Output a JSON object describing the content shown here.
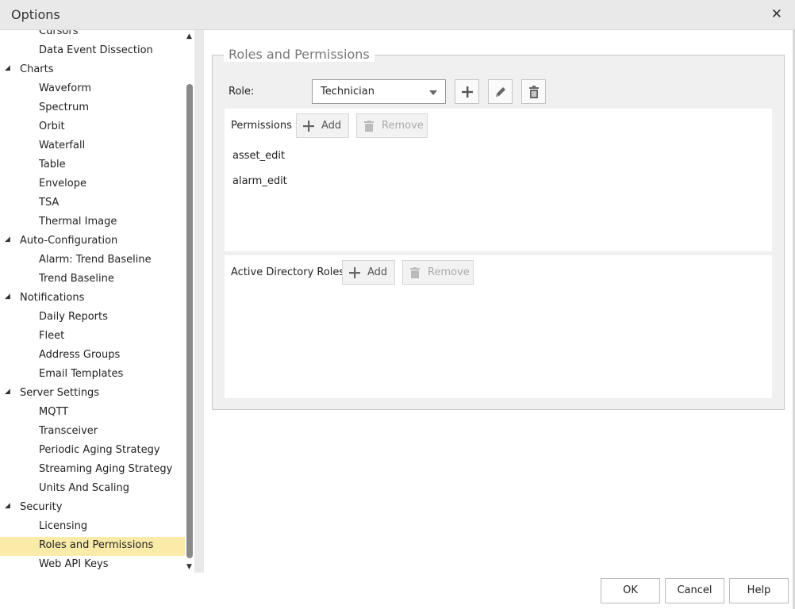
{
  "window": {
    "title": "Options",
    "close_glyph": "✕"
  },
  "tree": {
    "items": [
      {
        "label": "Cursors",
        "level": 1
      },
      {
        "label": "Data Event Dissection",
        "level": 1
      },
      {
        "label": "Charts",
        "level": 0,
        "expanded": true
      },
      {
        "label": "Waveform",
        "level": 1
      },
      {
        "label": "Spectrum",
        "level": 1
      },
      {
        "label": "Orbit",
        "level": 1
      },
      {
        "label": "Waterfall",
        "level": 1
      },
      {
        "label": "Table",
        "level": 1
      },
      {
        "label": "Envelope",
        "level": 1
      },
      {
        "label": "TSA",
        "level": 1
      },
      {
        "label": "Thermal Image",
        "level": 1
      },
      {
        "label": "Auto-Configuration",
        "level": 0,
        "expanded": true
      },
      {
        "label": "Alarm: Trend Baseline",
        "level": 1
      },
      {
        "label": "Trend Baseline",
        "level": 1
      },
      {
        "label": "Notifications",
        "level": 0,
        "expanded": true
      },
      {
        "label": "Daily Reports",
        "level": 1
      },
      {
        "label": "Fleet",
        "level": 1
      },
      {
        "label": "Address Groups",
        "level": 1
      },
      {
        "label": "Email Templates",
        "level": 1
      },
      {
        "label": "Server Settings",
        "level": 0,
        "expanded": true
      },
      {
        "label": "MQTT",
        "level": 1
      },
      {
        "label": "Transceiver",
        "level": 1
      },
      {
        "label": "Periodic Aging Strategy",
        "level": 1
      },
      {
        "label": "Streaming Aging Strategy",
        "level": 1
      },
      {
        "label": "Units And Scaling",
        "level": 1
      },
      {
        "label": "Security",
        "level": 0,
        "expanded": true
      },
      {
        "label": "Licensing",
        "level": 1
      },
      {
        "label": "Roles and Permissions",
        "level": 1,
        "selected": true
      },
      {
        "label": "Web API Keys",
        "level": 1
      }
    ],
    "selected_color": "#fbeba8"
  },
  "main": {
    "group_title": "Roles and Permissions",
    "role": {
      "label": "Role:",
      "selected": "Technician"
    },
    "permissions": {
      "title": "Permissions",
      "add_label": "Add",
      "remove_label": "Remove",
      "items": [
        "asset_edit",
        "alarm_edit"
      ]
    },
    "ad_roles": {
      "title": "Active Directory Roles",
      "add_label": "Add",
      "remove_label": "Remove"
    }
  },
  "footer": {
    "ok": "OK",
    "cancel": "Cancel",
    "help": "Help"
  }
}
